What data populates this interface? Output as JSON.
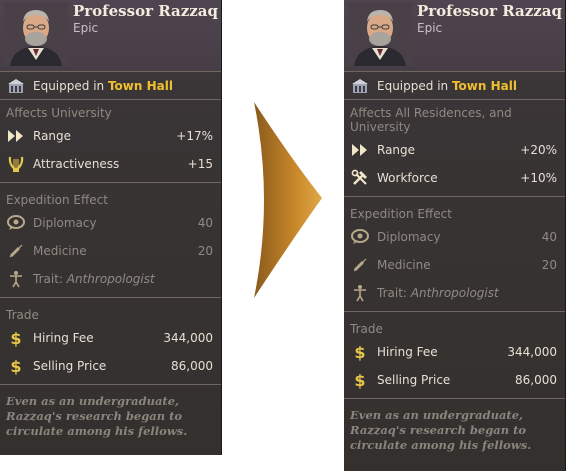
{
  "before": {
    "name": "Professor Razzaq",
    "rarity": "Epic",
    "equipped_prefix": "Equipped in",
    "equipped_building": "Town Hall",
    "affects": "Affects University",
    "stats": [
      {
        "icon": "fast-forward-icon",
        "label": "Range",
        "value": "+17%"
      },
      {
        "icon": "lyre-icon",
        "label": "Attractiveness",
        "value": "+15"
      }
    ],
    "expedition_title": "Expedition Effect",
    "expedition": [
      {
        "icon": "speech-bubble-icon",
        "label": "Diplomacy",
        "value": "40"
      },
      {
        "icon": "syringe-icon",
        "label": "Medicine",
        "value": "20"
      }
    ],
    "trait_prefix": "Trait:",
    "trait": "Anthropologist",
    "trade_title": "Trade",
    "trade": [
      {
        "icon": "dollar-icon",
        "label": "Hiring Fee",
        "value": "344,000"
      },
      {
        "icon": "dollar-icon",
        "label": "Selling Price",
        "value": "86,000"
      }
    ],
    "flavor": "Even as an undergraduate, Razzaq's research began to circulate among his fellows."
  },
  "after": {
    "name": "Professor Razzaq",
    "rarity": "Epic",
    "equipped_prefix": "Equipped in",
    "equipped_building": "Town Hall",
    "affects": "Affects All Residences, and University",
    "stats": [
      {
        "icon": "fast-forward-icon",
        "label": "Range",
        "value": "+20%"
      },
      {
        "icon": "hammer-wrench-icon",
        "label": "Workforce",
        "value": "+10%"
      }
    ],
    "expedition_title": "Expedition Effect",
    "expedition": [
      {
        "icon": "speech-bubble-icon",
        "label": "Diplomacy",
        "value": "40"
      },
      {
        "icon": "syringe-icon",
        "label": "Medicine",
        "value": "20"
      }
    ],
    "trait_prefix": "Trait:",
    "trait": "Anthropologist",
    "trade_title": "Trade",
    "trade": [
      {
        "icon": "dollar-icon",
        "label": "Hiring Fee",
        "value": "344,000"
      },
      {
        "icon": "dollar-icon",
        "label": "Selling Price",
        "value": "86,000"
      }
    ],
    "flavor": "Even as an undergraduate, Razzaq's research began to circulate among his fellows."
  },
  "colors": {
    "highlight": "#f0c030",
    "panel": "#33302e",
    "arrow": "#c8872a"
  }
}
